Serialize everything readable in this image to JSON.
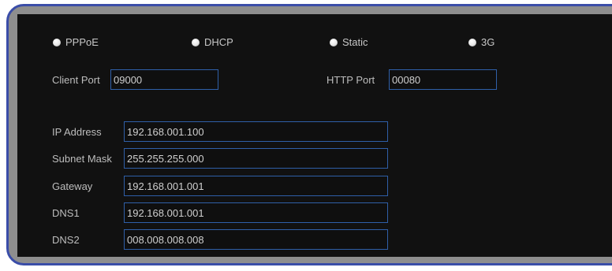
{
  "modes": [
    {
      "label": "PPPoE"
    },
    {
      "label": "DHCP"
    },
    {
      "label": "Static"
    },
    {
      "label": "3G"
    }
  ],
  "ports": {
    "client_port_label": "Client Port",
    "client_port_value": "09000",
    "http_port_label": "HTTP Port",
    "http_port_value": "00080"
  },
  "network": {
    "ip_address_label": "IP Address",
    "ip_address_value": "192.168.001.100",
    "subnet_mask_label": "Subnet Mask",
    "subnet_mask_value": "255.255.255.000",
    "gateway_label": "Gateway",
    "gateway_value": "192.168.001.001",
    "dns1_label": "DNS1",
    "dns1_value": "192.168.001.001",
    "dns2_label": "DNS2",
    "dns2_value": "008.008.008.008"
  },
  "colors": {
    "frame_border": "#3a4da8",
    "panel_bg": "#111111",
    "field_border": "#2f5fa8",
    "text": "#c8c8c8"
  }
}
